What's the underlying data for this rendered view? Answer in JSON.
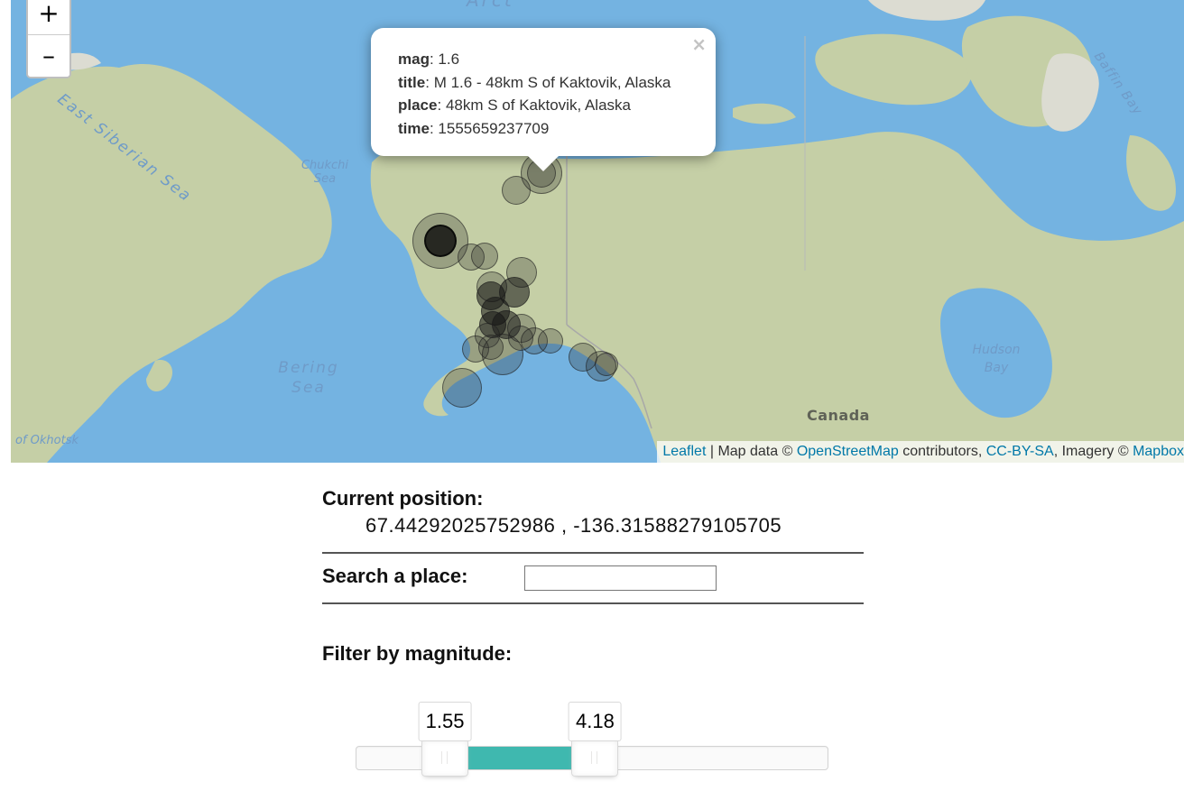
{
  "map": {
    "zoom_in_label": "+",
    "zoom_out_label": "–",
    "water_labels": {
      "arctic": "Arct",
      "east_siberian": "East Siberian Sea",
      "chukchi_line1": "Chukchi",
      "chukchi_line2": "Sea",
      "bering_line1": "Bering",
      "bering_line2": "Sea",
      "okhotsk": "of Okhotsk",
      "baffin": "Baffin Bay",
      "hudson_line1": "Hudson",
      "hudson_line2": "Bay"
    },
    "land_labels": {
      "canada": "Canada"
    },
    "popup": {
      "close": "×",
      "mag_key": "mag",
      "mag_value": "1.6",
      "title_key": "title",
      "title_value": "M 1.6 - 48km S of Kaktovik, Alaska",
      "place_key": "place",
      "place_value": "48km S of Kaktovik, Alaska",
      "time_key": "time",
      "time_value": "1555659237709"
    },
    "attribution": {
      "leaflet": "Leaflet",
      "sep1": " | Map data © ",
      "osm": "OpenStreetMap",
      "contributors": " contributors, ",
      "license": "CC-BY-SA",
      "imagery": ", Imagery © ",
      "mapbox": "Mapbox"
    },
    "colors": {
      "water": "#74b3e1",
      "land": "#c5cfa6",
      "marker": "#282828"
    }
  },
  "panel": {
    "position_heading": "Current position:",
    "position_value": "67.44292025752986 , -136.31588279105705",
    "search_label": "Search a place:",
    "search_value": "",
    "filter_label": "Filter by magnitude:",
    "slider": {
      "min": 0,
      "max": 8.25,
      "low": 1.55,
      "high": 4.18,
      "low_label": "1.55",
      "high_label": "4.18",
      "connect_color": "#3fb8af"
    }
  }
}
